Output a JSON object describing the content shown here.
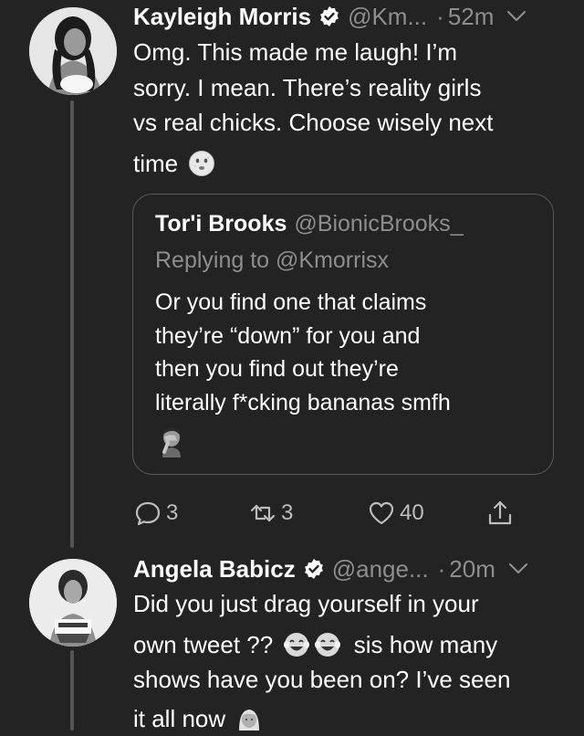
{
  "tweet1": {
    "name": "Kayleigh Morris",
    "handle": "@Km...",
    "separator": "·",
    "time": "52m",
    "lines": [
      "Omg. This made me laugh! I’m",
      "sorry. I mean. There’s reality girls",
      "vs real chicks. Choose wisely next",
      "time"
    ],
    "emoji": "pale-face-emoji",
    "quote": {
      "name": "Tor'i Brooks",
      "handle": "@BionicBrooks_",
      "replying": "Replying to @Kmorrisx",
      "lines": [
        "Or you find one that claims",
        "they’re “down” for you and",
        "then you find out they’re",
        "literally f*cking bananas smfh"
      ],
      "emoji": "facepalm-emoji"
    },
    "actions": {
      "replies": "3",
      "retweets": "3",
      "likes": "40"
    }
  },
  "tweet2": {
    "name": "Angela Babicz",
    "handle": "@ange...",
    "separator": "·",
    "time": "20m",
    "lines": [
      "Did you just drag yourself in your",
      "own tweet ??",
      "sis how many",
      "shows have you been on? I’ve seen",
      "it all now"
    ],
    "emojis": [
      "tears-of-joy-emoji",
      "tears-of-joy-emoji",
      "woman-emoji"
    ]
  },
  "colors": {
    "background": "#232323",
    "text": "#ffffff",
    "muted": "#8e8e8e",
    "thread_line": "#555555",
    "border": "#5a5a5a"
  }
}
